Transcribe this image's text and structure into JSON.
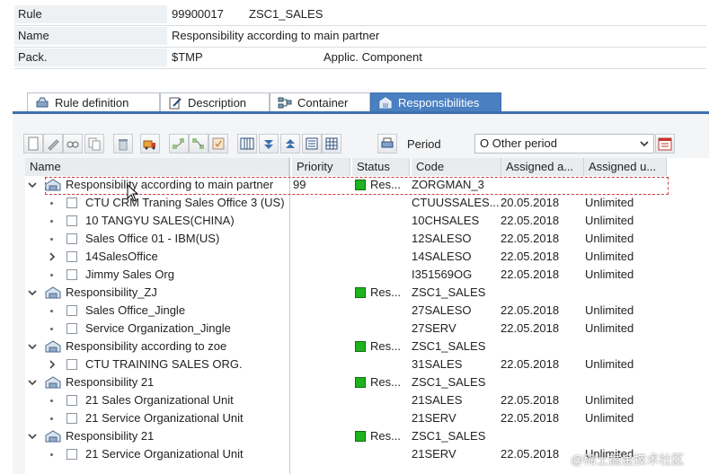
{
  "header": {
    "rule_label": "Rule",
    "rule_number": "99900017",
    "rule_name": "ZSC1_SALES",
    "name_label": "Name",
    "name_value": "Responsibility according to main partner",
    "pack_label": "Pack.",
    "pack_value": "$TMP",
    "applic_label": "Applic. Component"
  },
  "tabs": [
    {
      "label": "Rule definition",
      "icon": "rule-definition-icon"
    },
    {
      "label": "Description",
      "icon": "description-icon"
    },
    {
      "label": "Container",
      "icon": "container-icon"
    },
    {
      "label": "Responsibilities",
      "icon": "responsibilities-icon",
      "active": true
    }
  ],
  "toolbar": {
    "period_label": "Period",
    "period_value": "O Other period"
  },
  "columns": [
    "Name",
    "Priority",
    "Status",
    "Code",
    "Assigned a...",
    "Assigned u..."
  ],
  "rows": [
    {
      "level": 0,
      "expander": "down",
      "name": "Responsibility according to main partner",
      "priority": "99",
      "status": "Res...",
      "code": "ZORGMAN_3",
      "from": "",
      "to": ""
    },
    {
      "level": 1,
      "expander": "bullet",
      "name": "CTU CRM Traning Sales Office 3 (US)",
      "priority": "",
      "status": "",
      "code": "CTUUSSALES...",
      "from": "20.05.2018",
      "to": "Unlimited"
    },
    {
      "level": 1,
      "expander": "bullet",
      "name": "10 TANGYU SALES(CHINA)",
      "priority": "",
      "status": "",
      "code": "10CHSALES",
      "from": "22.05.2018",
      "to": "Unlimited"
    },
    {
      "level": 1,
      "expander": "bullet",
      "name": "Sales Office 01 - IBM(US)",
      "priority": "",
      "status": "",
      "code": "12SALESO",
      "from": "22.05.2018",
      "to": "Unlimited"
    },
    {
      "level": 1,
      "expander": "right",
      "name": "14SalesOffice",
      "priority": "",
      "status": "",
      "code": "14SALESO",
      "from": "22.05.2018",
      "to": "Unlimited"
    },
    {
      "level": 1,
      "expander": "bullet",
      "name": "Jimmy Sales Org",
      "priority": "",
      "status": "",
      "code": "I351569OG",
      "from": "22.05.2018",
      "to": "Unlimited"
    },
    {
      "level": 0,
      "expander": "down",
      "name": "Responsibility_ZJ",
      "priority": "",
      "status": "Res...",
      "code": "ZSC1_SALES",
      "from": "",
      "to": ""
    },
    {
      "level": 1,
      "expander": "bullet",
      "name": "Sales Office_Jingle",
      "priority": "",
      "status": "",
      "code": "27SALESO",
      "from": "22.05.2018",
      "to": "Unlimited"
    },
    {
      "level": 1,
      "expander": "bullet",
      "name": "Service Organization_Jingle",
      "priority": "",
      "status": "",
      "code": "27SERV",
      "from": "22.05.2018",
      "to": "Unlimited"
    },
    {
      "level": 0,
      "expander": "down",
      "name": "Responsibility according to zoe",
      "priority": "",
      "status": "Res...",
      "code": "ZSC1_SALES",
      "from": "",
      "to": ""
    },
    {
      "level": 1,
      "expander": "right",
      "name": "CTU TRAINING SALES ORG.",
      "priority": "",
      "status": "",
      "code": "31SALES",
      "from": "22.05.2018",
      "to": "Unlimited"
    },
    {
      "level": 0,
      "expander": "down",
      "name": "Responsibility 21",
      "priority": "",
      "status": "Res...",
      "code": "ZSC1_SALES",
      "from": "",
      "to": ""
    },
    {
      "level": 1,
      "expander": "bullet",
      "name": "21 Sales Organizational Unit",
      "priority": "",
      "status": "",
      "code": "21SALES",
      "from": "22.05.2018",
      "to": "Unlimited"
    },
    {
      "level": 1,
      "expander": "bullet",
      "name": "21 Service Organizational Unit",
      "priority": "",
      "status": "",
      "code": "21SERV",
      "from": "22.05.2018",
      "to": "Unlimited"
    },
    {
      "level": 0,
      "expander": "down",
      "name": "Responsibility 21",
      "priority": "",
      "status": "Res...",
      "code": "ZSC1_SALES",
      "from": "",
      "to": ""
    },
    {
      "level": 1,
      "expander": "bullet",
      "name": "21 Service Organizational Unit",
      "priority": "",
      "status": "",
      "code": "21SERV",
      "from": "22.05.2018",
      "to": "Unlimited"
    }
  ],
  "colors": {
    "accent": "#4a7fc1",
    "status_green": "#1fb21f"
  },
  "watermark": "@稀土掘金技术社区"
}
